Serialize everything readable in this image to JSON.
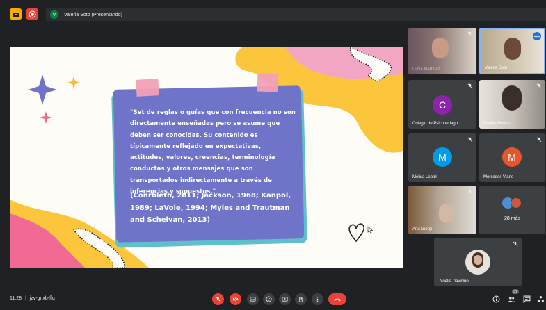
{
  "top_bar": {
    "presenter_initial": "V",
    "presenter_label": "Valeria Soto (Presentando)"
  },
  "slide": {
    "quote": "\"Set de reglas o guías que con frecuencia no son directamente enseñadas pero se asume que deben ser conocidas. Su contenido es típicamente reflejado en expectativas, actitudes, valores, creencias, terminología conductas y otros mensajes que son transportados indirectamente a través de inferencias y supuestos.\"",
    "citation": "(Conrbleth, 2011; Jackson, 1968; Kanpol, 1989; LaVoie, 1994; Myles and Trautman and Schelvan, 2013)"
  },
  "participants": [
    {
      "name": "Lucía Martínez"
    },
    {
      "name": "Valeria Soto"
    },
    {
      "name": "Colegio de Psicopedago...",
      "initial": "C",
      "color": "#8e24aa"
    },
    {
      "name": "Natalia Ferrero"
    },
    {
      "name": "Melisa Lepori",
      "initial": "M",
      "color": "#039be5"
    },
    {
      "name": "Mercedes Viano",
      "initial": "M",
      "color": "#e8572b"
    },
    {
      "name": "Ana Giorgi"
    },
    {
      "name": "28 más"
    },
    {
      "name": "Noelia Davicino"
    }
  ],
  "bottom_bar": {
    "time": "11:28",
    "meeting_code": "jzv-gnxb-ffq",
    "people_count": "37"
  },
  "colors": {
    "background": "#202124",
    "tile": "#3c4043",
    "danger": "#ea4335",
    "card": "#6f74c9",
    "card_shadow": "#5fc0cc"
  }
}
